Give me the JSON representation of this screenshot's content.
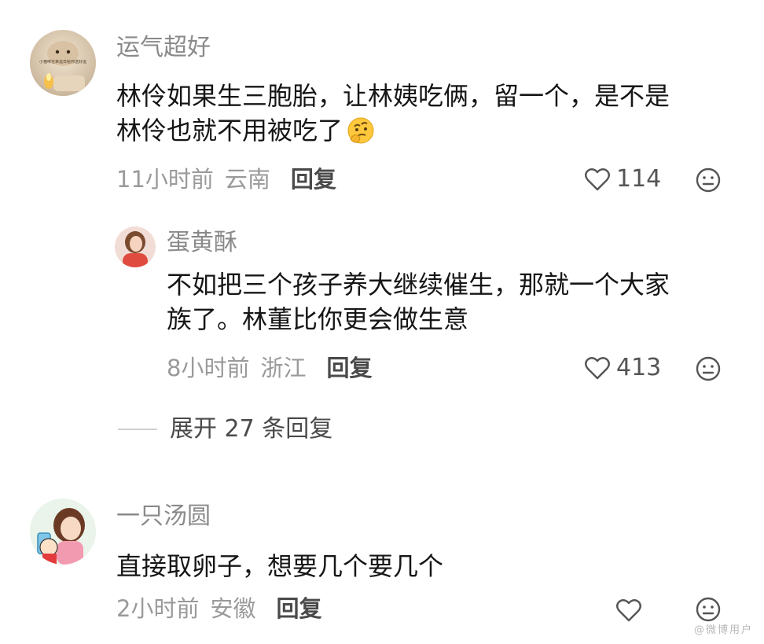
{
  "comments": [
    {
      "username": "运气超好",
      "content_line1": "林伶如果生三胞胎，让林姨吃俩，留一个，是不是",
      "content_line2": "林伶也就不用被吃了",
      "emoji": "thinking-face",
      "time": "11小时前",
      "location": "云南",
      "reply_label": "回复",
      "likes": "114",
      "avatar_caption": "小猫咪在幸运日给你送好运"
    },
    {
      "username": "一只汤圆",
      "content_line1": "直接取卵子，想要几个要几个",
      "time": "2小时前",
      "location": "安徽",
      "reply_label": "回复"
    }
  ],
  "sub_reply": {
    "username": "蛋黄酥",
    "content_line1": "不如把三个孩子养大继续催生，那就一个大家",
    "content_line2": "族了。林董比你更会做生意",
    "time": "8小时前",
    "location": "浙江",
    "reply_label": "回复",
    "likes": "413"
  },
  "expand_replies": "展开 27 条回复",
  "watermark": "@微博用户",
  "colors": {
    "username": "#8a8a8a",
    "meta": "#9a9a9a",
    "content": "#161616",
    "icon": "#555555"
  }
}
